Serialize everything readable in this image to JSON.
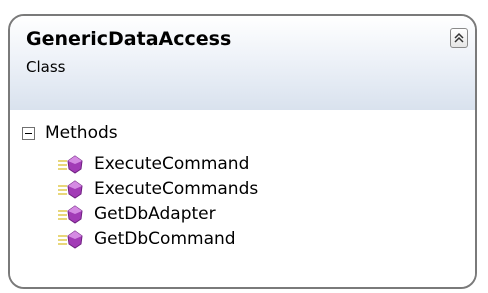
{
  "class": {
    "name": "GenericDataAccess",
    "kind": "Class"
  },
  "icons": {
    "collapse": "double-chevron-up-icon",
    "method": "method-icon",
    "section_toggle": "minus-icon"
  },
  "colors": {
    "header_top": "#ffffff",
    "header_bottom": "#d9e2ee",
    "border": "#7a7a7a",
    "method_icon_purple": "#a23bb6"
  },
  "sections": {
    "methods": {
      "label": "Methods",
      "items": [
        {
          "name": "ExecuteCommand"
        },
        {
          "name": "ExecuteCommands"
        },
        {
          "name": "GetDbAdapter"
        },
        {
          "name": "GetDbCommand"
        }
      ]
    }
  }
}
